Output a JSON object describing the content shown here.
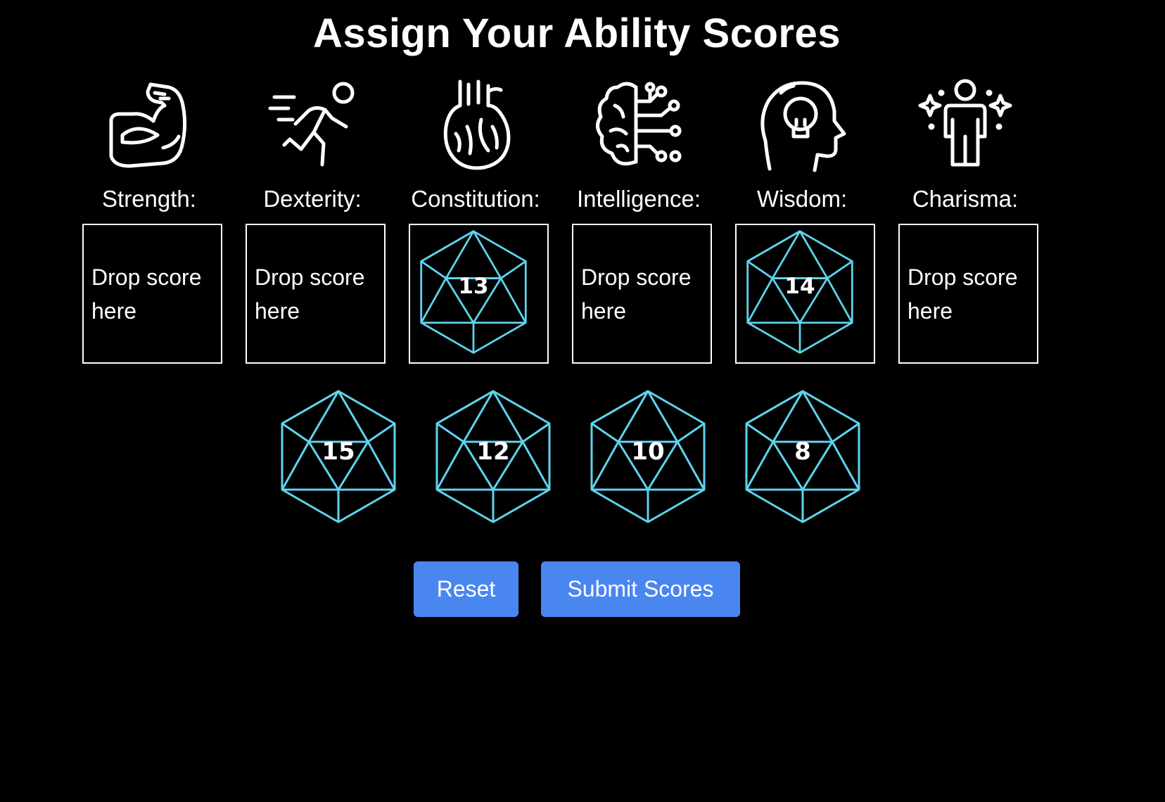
{
  "title": "Assign Your Ability Scores",
  "abilities": [
    {
      "label": "Strength:",
      "icon": "flexed-arm-icon",
      "assigned": null,
      "placeholder": "Drop score here"
    },
    {
      "label": "Dexterity:",
      "icon": "running-person-icon",
      "assigned": null,
      "placeholder": "Drop score here"
    },
    {
      "label": "Constitution:",
      "icon": "anatomical-heart-icon",
      "assigned": "13",
      "placeholder": "Drop score here"
    },
    {
      "label": "Intelligence:",
      "icon": "circuit-brain-icon",
      "assigned": null,
      "placeholder": "Drop score here"
    },
    {
      "label": "Wisdom:",
      "icon": "lightbulb-head-icon",
      "assigned": "14",
      "placeholder": "Drop score here"
    },
    {
      "label": "Charisma:",
      "icon": "sparkle-person-icon",
      "assigned": null,
      "placeholder": "Drop score here"
    }
  ],
  "pool": [
    "15",
    "12",
    "10",
    "8"
  ],
  "buttons": {
    "reset": "Reset",
    "submit": "Submit Scores"
  },
  "colors": {
    "background": "#000000",
    "die_stroke": "#5fd4ee",
    "button": "#4a86f0",
    "text": "#ffffff"
  }
}
